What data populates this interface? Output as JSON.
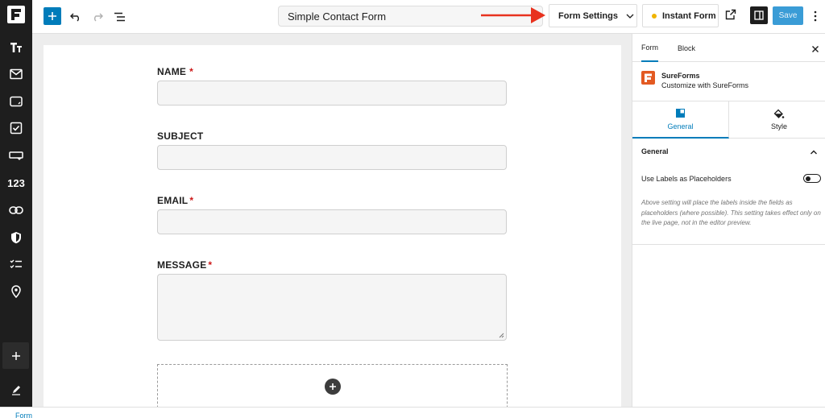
{
  "toolbar": {
    "document_title": "Simple Contact Form",
    "form_settings_label": "Form Settings",
    "instant_form_label": "Instant Form",
    "save_label": "Save"
  },
  "sidebar": {
    "items": [
      {
        "icon": "text-icon"
      },
      {
        "icon": "email-icon"
      },
      {
        "icon": "textarea-icon"
      },
      {
        "icon": "checkbox-icon"
      },
      {
        "icon": "dropdown-icon"
      },
      {
        "icon": "number-icon",
        "text": "123"
      },
      {
        "icon": "link-icon"
      },
      {
        "icon": "shield-icon"
      },
      {
        "icon": "multi-choice-icon"
      },
      {
        "icon": "location-pin-icon"
      }
    ]
  },
  "form": {
    "fields": [
      {
        "label": "NAME",
        "required": true,
        "asterisk": "*"
      },
      {
        "label": "SUBJECT",
        "required": false
      },
      {
        "label": "EMAIL",
        "required": true,
        "asterisk": "*"
      },
      {
        "label": "MESSAGE",
        "required": true,
        "asterisk": "*"
      }
    ]
  },
  "panel": {
    "tabs": {
      "form": "Form",
      "block": "Block"
    },
    "plugin_name": "SureForms",
    "plugin_desc": "Customize with SureForms",
    "sub_tabs": {
      "general": "General",
      "style": "Style"
    },
    "section_title": "General",
    "setting_label": "Use Labels as Placeholders",
    "setting_enabled": false,
    "help_text": "Above setting will place the labels inside the fields as placeholders (where possible). This setting takes effect only on the live page, not in the editor preview."
  },
  "footer": {
    "breadcrumb": "Form"
  },
  "colors": {
    "accent": "#007cba",
    "arrow": "#e8321e",
    "brand": "#e35a22",
    "required": "#cc1818",
    "status_dot": "#f0b400"
  }
}
